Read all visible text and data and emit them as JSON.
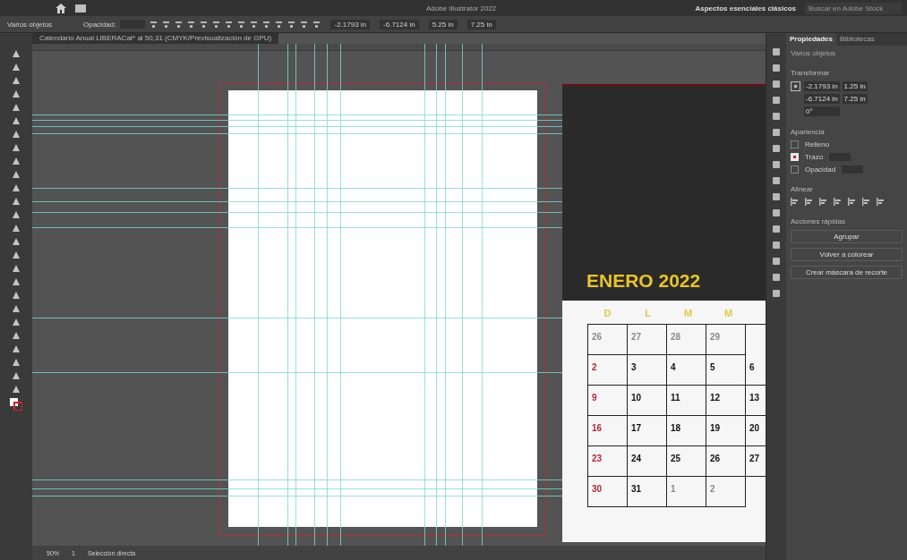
{
  "menu_bar": {
    "title": "Adobe Illustrator 2022",
    "workspace": "Aspectos esenciales clásicos",
    "search": {
      "placeholder": "Buscar en Adobe Stock"
    }
  },
  "control_bar": {
    "selection": "Varios objetos",
    "opacity_label": "Opacidad:",
    "x": "-2.1793 in",
    "y": "-6.7124 in",
    "w": "5.25 in",
    "h": "7.25 in"
  },
  "document_tab": {
    "title": "Calendario Anual LIBERACat* al 50,31 (CMYK/Previsualización de GPU)"
  },
  "calendar": {
    "title": "ENERO 2022",
    "weekdays": [
      "D",
      "L",
      "M",
      "M"
    ],
    "weeks": [
      [
        {
          "day": "26",
          "muted": true
        },
        {
          "day": "27",
          "muted": true
        },
        {
          "day": "28",
          "muted": true
        },
        {
          "day": "29",
          "muted": true
        }
      ],
      [
        {
          "day": "2",
          "muted": false
        },
        {
          "day": "3",
          "muted": false
        },
        {
          "day": "4",
          "muted": false
        },
        {
          "day": "5",
          "muted": false
        },
        {
          "day": "6",
          "muted": false
        }
      ],
      [
        {
          "day": "9",
          "muted": false
        },
        {
          "day": "10",
          "muted": false
        },
        {
          "day": "11",
          "muted": false
        },
        {
          "day": "12",
          "muted": false
        },
        {
          "day": "13",
          "muted": false
        }
      ],
      [
        {
          "day": "16",
          "muted": false
        },
        {
          "day": "17",
          "muted": false
        },
        {
          "day": "18",
          "muted": false
        },
        {
          "day": "19",
          "muted": false
        },
        {
          "day": "20",
          "muted": false
        }
      ],
      [
        {
          "day": "23",
          "muted": false
        },
        {
          "day": "24",
          "muted": false
        },
        {
          "day": "25",
          "muted": false
        },
        {
          "day": "26",
          "muted": false
        },
        {
          "day": "27",
          "muted": false
        }
      ],
      [
        {
          "day": "30",
          "muted": false
        },
        {
          "day": "31",
          "muted": false
        },
        {
          "day": "1",
          "muted": true
        },
        {
          "day": "2",
          "muted": true
        }
      ]
    ]
  },
  "panel": {
    "tabs": [
      {
        "label": "Propiedades",
        "selected": true
      },
      {
        "label": "Bibliotecas",
        "selected": false
      }
    ],
    "selection": "Varios objetos",
    "transform": {
      "title": "Transformar",
      "x": "-2.1793 in",
      "w": "1.25 in",
      "y": "-6.7124 in",
      "h": "7.25 in",
      "angle": "0°"
    },
    "appearance": {
      "title": "Apariencia",
      "fill": "Relleno",
      "stroke": "Trazo",
      "opacity": "Opacidad"
    },
    "align": {
      "title": "Alinear"
    },
    "quick_actions": {
      "title": "Acciones rápidas",
      "buttons": [
        "Agrupar",
        "Volver a colorear",
        "Crear máscara de recorte"
      ]
    }
  },
  "status_bar": {
    "zoom": "50%",
    "artboard": "1",
    "tool": "Selección directa"
  }
}
